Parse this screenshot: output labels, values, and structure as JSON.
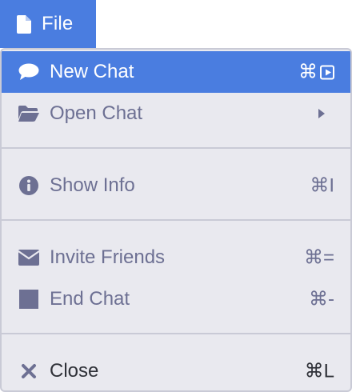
{
  "file_menu": {
    "label": "File",
    "icon": "file-icon"
  },
  "menu": {
    "items": [
      {
        "label": "New Chat",
        "icon": "chat-bubble-icon",
        "shortcut": "⌘",
        "shortcut_icon": "play-box-icon",
        "selected": true
      },
      {
        "label": "Open Chat",
        "icon": "folder-open-icon",
        "submenu": true
      },
      {
        "label": "Show Info",
        "icon": "info-circle-icon",
        "shortcut": "⌘I"
      },
      {
        "label": "Invite Friends",
        "icon": "envelope-icon",
        "shortcut": "⌘="
      },
      {
        "label": "End Chat",
        "icon": "stop-square-icon",
        "shortcut": "⌘-"
      },
      {
        "label": "Close",
        "icon": "close-x-icon",
        "shortcut": "⌘L"
      }
    ]
  },
  "colors": {
    "accent": "#4a7de0",
    "menu_background": "#e9e9ef",
    "muted_text": "#6d7093",
    "dark_text": "#2f3138",
    "divider": "#c9cad6"
  }
}
